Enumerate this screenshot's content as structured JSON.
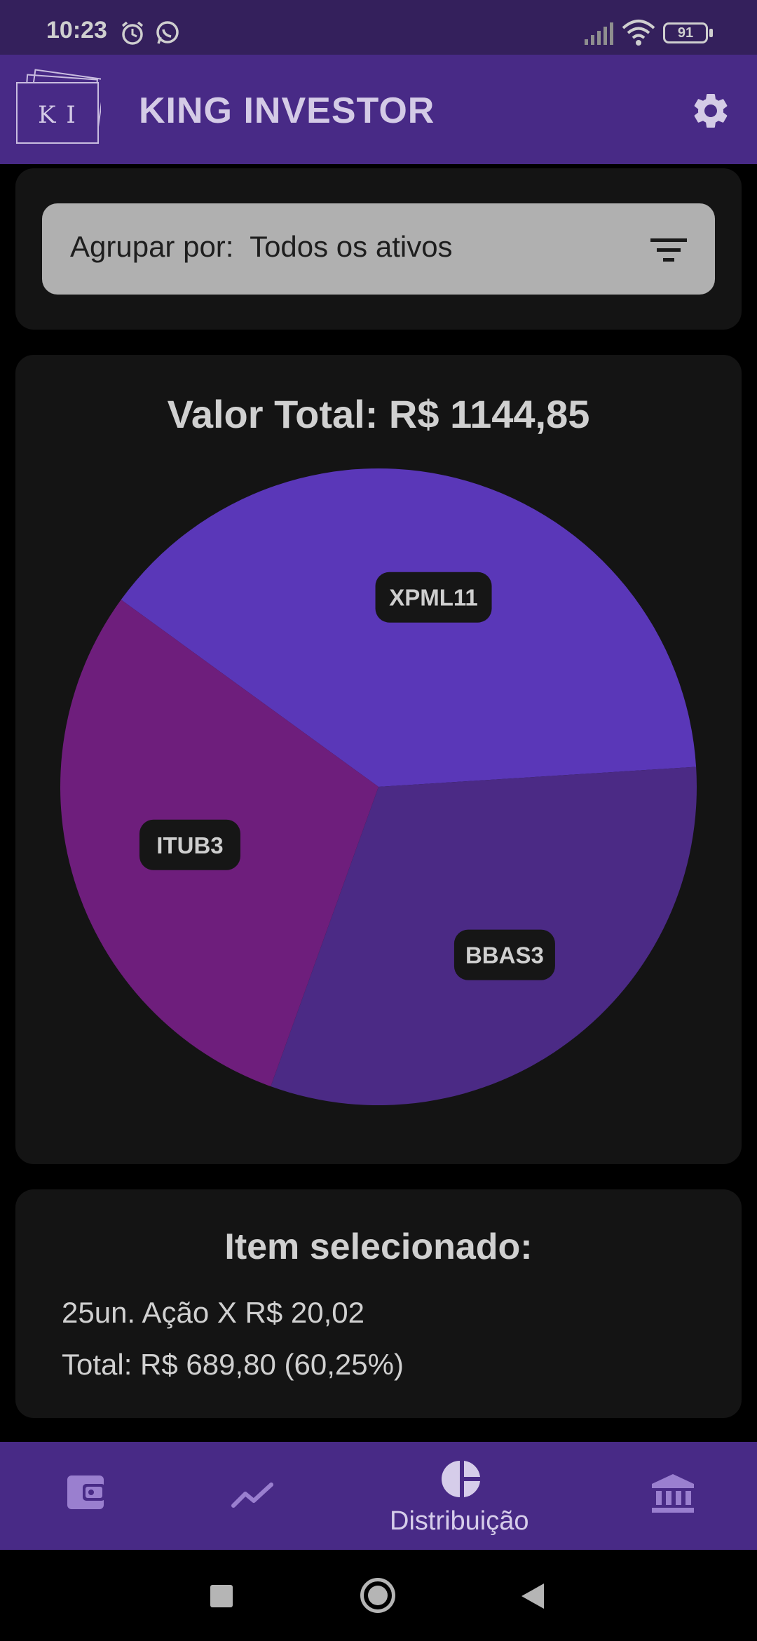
{
  "status_bar": {
    "time": "10:23",
    "battery": "91",
    "icons": [
      "alarm-icon",
      "whatsapp-icon",
      "signal-icon",
      "wifi-icon",
      "battery-icon"
    ]
  },
  "app_bar": {
    "logo_text": "K I",
    "title": "KING INVESTOR",
    "settings_icon": "gear-icon"
  },
  "filter": {
    "label": "Agrupar por:",
    "value": "Todos os ativos",
    "icon": "filter-icon"
  },
  "chart": {
    "title": "Valor Total: R$ 1144,85"
  },
  "chart_data": {
    "type": "pie",
    "title": "Valor Total: R$ 1144,85",
    "slices": [
      {
        "label": "XPML11",
        "value": 39.0,
        "color": "#5a37b8"
      },
      {
        "label": "BBAS3",
        "value": 31.5,
        "color": "#4b2a85"
      },
      {
        "label": "ITUB3",
        "value": 29.5,
        "color": "#6e1e7c"
      }
    ],
    "colors": [
      "#5a37b8",
      "#4b2a85",
      "#6e1e7c"
    ]
  },
  "selected_item": {
    "title": "Item selecionado:",
    "line1": "25un. Ação X R$ 20,02",
    "line2": "Total: R$ 689,80 (60,25%)"
  },
  "bottom_nav": {
    "items": [
      {
        "icon": "wallet-icon",
        "label": ""
      },
      {
        "icon": "trending-icon",
        "label": ""
      },
      {
        "icon": "pie-chart-icon",
        "label": "Distribuição",
        "active": true
      },
      {
        "icon": "bank-icon",
        "label": ""
      }
    ]
  },
  "system_nav": {
    "icons": [
      "recents-icon",
      "home-icon",
      "back-icon"
    ]
  }
}
